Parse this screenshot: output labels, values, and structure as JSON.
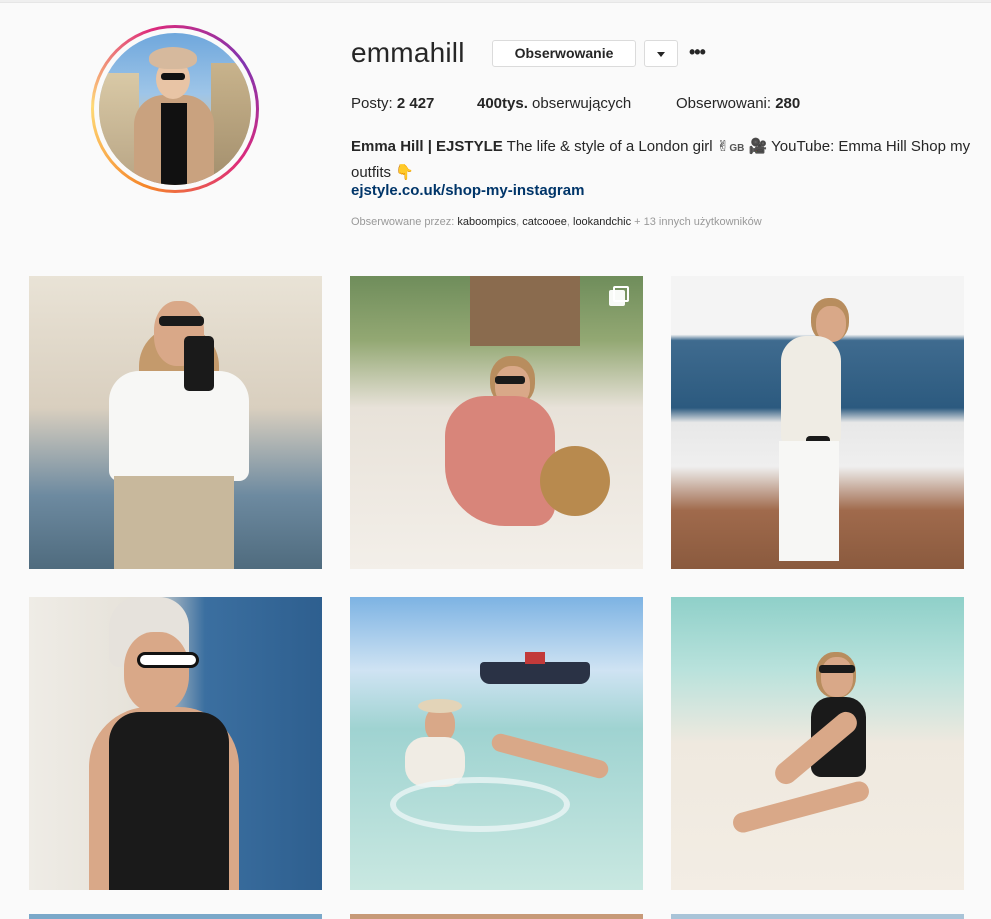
{
  "profile": {
    "username": "emmahill",
    "follow_label": "Obserwowanie",
    "dropdown_icon": "chevron-down-icon",
    "more_label": "•••",
    "stats": {
      "posts_label": "Posty:",
      "posts_value": "2 427",
      "followers_value": "400tys.",
      "followers_label": "obserwujących",
      "following_label": "Obserwowani:",
      "following_value": "280"
    },
    "bio": {
      "name": "Emma Hill | EJSTYLE",
      "text_1": "The life & style of a London girl",
      "hand_emoji": "✌",
      "flag": "GB",
      "camera_emoji": "🎥",
      "text_2": "YouTube: Emma Hill Shop my outfits",
      "point_emoji": "👇"
    },
    "link": "ejstyle.co.uk/shop-my-instagram",
    "followed_by": {
      "prefix": "Obserwowane przez:",
      "users": [
        "kaboompics",
        "catcooee",
        "lookandchic"
      ],
      "suffix": "+ 13 innych użytkowników"
    }
  },
  "posts": [
    {
      "id": "post-1",
      "type": "photo"
    },
    {
      "id": "post-2",
      "type": "carousel"
    },
    {
      "id": "post-3",
      "type": "photo"
    },
    {
      "id": "post-4",
      "type": "photo"
    },
    {
      "id": "post-5",
      "type": "photo"
    },
    {
      "id": "post-6",
      "type": "photo"
    }
  ]
}
